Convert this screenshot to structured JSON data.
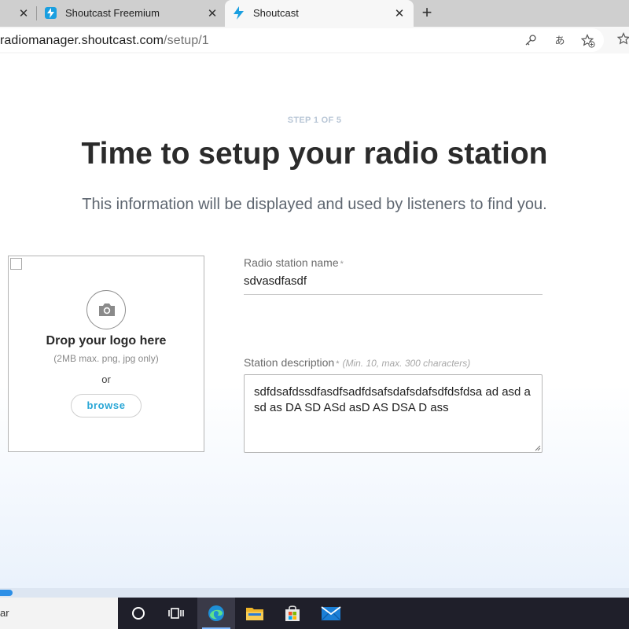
{
  "browser": {
    "tabs": [
      {
        "title": "",
        "active": false
      },
      {
        "title": "Shoutcast Freemium",
        "active": false
      },
      {
        "title": "Shoutcast",
        "active": true
      }
    ],
    "url": {
      "host": "radiomanager.shoutcast.com",
      "path": "/setup/1"
    }
  },
  "page": {
    "step_label": "STEP 1 OF 5",
    "title": "Time to setup your radio station",
    "subtitle": "This information will be displayed and used by listeners to find you.",
    "logo_upload": {
      "drop_text": "Drop your logo here",
      "hint": "(2MB max. png, jpg only)",
      "or_text": "or",
      "browse_label": "browse"
    },
    "station_name": {
      "label": "Radio station name",
      "required_mark": "*",
      "value": "sdvasdfasdf"
    },
    "station_description": {
      "label": "Station description",
      "required_mark": "*",
      "hint": "(Min. 10, max. 300 characters)",
      "value": "sdfdsafdssdfasdfsadfdsafsdafsdafsdfdsfdsa ad asd asd as DA SD ASd asD AS DSA D ass"
    }
  },
  "progress_percent": 2,
  "taskbar": {
    "search_text": "ar",
    "icons": [
      "search-circle-icon",
      "task-view-icon",
      "edge-icon",
      "file-explorer-icon",
      "store-icon",
      "mail-icon"
    ]
  },
  "colors": {
    "accent": "#2aa7d6",
    "progress": "#2d8fe6",
    "title_text": "#2b2b2b"
  }
}
